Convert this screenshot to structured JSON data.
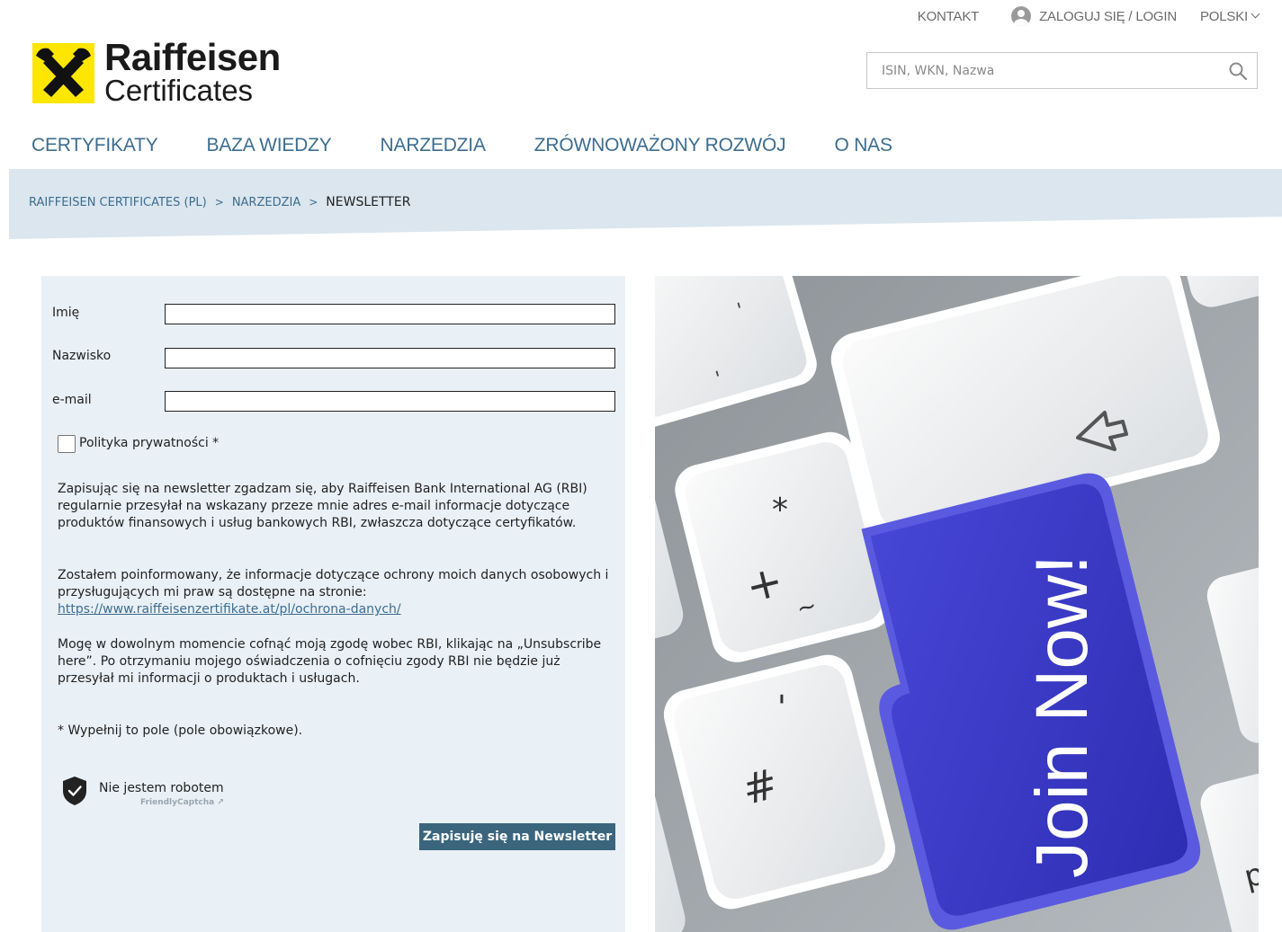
{
  "topbar": {
    "contact": "KONTAKT",
    "login": "ZALOGUJ SIĘ / LOGIN",
    "language": "POLSKI"
  },
  "logo": {
    "line1": "Raiffeisen",
    "line2": "Certificates"
  },
  "search": {
    "placeholder": "ISIN, WKN, Nazwa"
  },
  "nav": {
    "items": [
      "CERTYFIKATY",
      "BAZA WIEDZY",
      "NARZEDZIA",
      "ZRÓWNOWAŻONY ROZWÓJ",
      "O NAS"
    ]
  },
  "breadcrumb": {
    "home": "RAIFFEISEN CERTIFICATES (PL)",
    "section": "NARZEDZIA",
    "current": "NEWSLETTER",
    "separator": ">"
  },
  "form": {
    "first_name_label": "Imię",
    "last_name_label": "Nazwisko",
    "email_label": "e-mail",
    "first_name_value": "",
    "last_name_value": "",
    "email_value": "",
    "privacy_label": "Polityka prywatności *",
    "privacy_checked": false,
    "para1": "Zapisując się na newsletter zgadzam się, aby Raiffeisen Bank International AG (RBI) regularnie przesyłał na wskazany przeze mnie adres e-mail informacje dotyczące produktów finansowych i usług bankowych RBI, zwłaszcza dotyczące certyfikatów.",
    "para2": "Zostałem poinformowany, że informacje dotyczące ochrony moich danych osobowych i przysługujących mi praw są dostępne na stronie:",
    "privacy_link": "https://www.raiffeisenzertifikate.at/pl/ochrona-danych/",
    "para3": "Mogę w dowolnym momencie cofnąć moją zgodę wobec RBI, klikając na „Unsubscribe here”. Po otrzymaniu mojego oświadczenia o cofnięciu zgody RBI nie będzie już przesyłał mi informacji o produktach i usługach.",
    "required_note": "* Wypełnij to pole (pole obowiązkowe).",
    "captcha_text": "Nie jestem robotem",
    "captcha_brand": "FriendlyCaptcha ↗",
    "submit_label": "Zapisuję się na Newsletter"
  },
  "image": {
    "key_text": "Join Now!",
    "key_symbols": {
      "star": "*",
      "plus": "+",
      "tilde": "~",
      "apostrophe": "'",
      "hash": "#",
      "p": "p"
    }
  },
  "colors": {
    "brand_yellow": "#fee600",
    "link_blue": "#3d6d8f",
    "panel_bg": "#e9f0f6",
    "band_bg": "#dbe6ee",
    "button_bg": "#3a657d",
    "key_blue": "#3c3ccc"
  },
  "icons": {
    "user": "user-circle-icon",
    "chevron": "chevron-down-icon",
    "search": "search-icon",
    "captcha": "shield-check-icon"
  }
}
